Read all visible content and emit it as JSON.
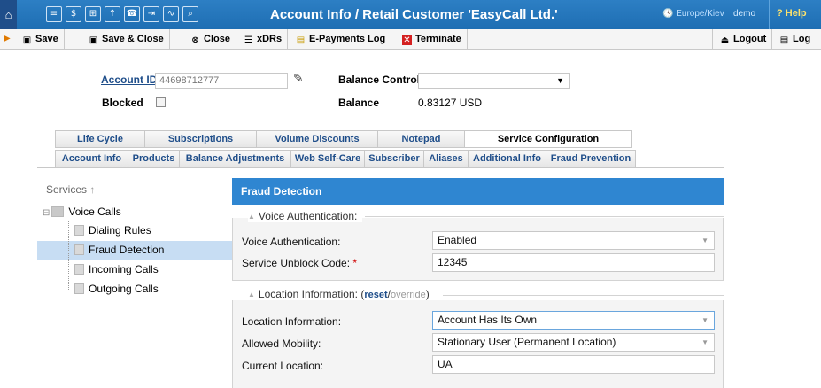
{
  "topbar": {
    "title": "Account Info / Retail Customer 'EasyCall Ltd.'",
    "timezone": "Europe/Kiev",
    "user": "demo",
    "help": "Help"
  },
  "toolbar": {
    "save": "Save",
    "save_close": "Save & Close",
    "close": "Close",
    "xdrs": "xDRs",
    "epayments": "E-Payments Log",
    "terminate": "Terminate",
    "logout": "Logout",
    "log": "Log"
  },
  "account": {
    "id_label": "Account ID",
    "id_value": "44698712777",
    "blocked_label": "Blocked",
    "balance_control_label": "Balance Control",
    "balance_label": "Balance",
    "balance_value": "0.83127 USD"
  },
  "tabs_row1": [
    "Life Cycle",
    "Subscriptions",
    "Volume Discounts",
    "Notepad",
    "Service Configuration"
  ],
  "tabs_row2": [
    "Account Info",
    "Products",
    "Balance Adjustments",
    "Web Self-Care",
    "Subscriber",
    "Aliases",
    "Additional Info",
    "Fraud Prevention"
  ],
  "services": {
    "heading": "Services",
    "root": "Voice Calls",
    "items": [
      "Dialing Rules",
      "Fraud Detection",
      "Incoming Calls",
      "Outgoing Calls"
    ]
  },
  "panel": {
    "title": "Fraud Detection",
    "voice_group": "Voice Authentication:",
    "voice_auth_label": "Voice Authentication:",
    "voice_auth_value": "Enabled",
    "unblock_label": "Service Unblock Code:",
    "unblock_value": "12345",
    "location_group": "Location Information:",
    "reset": "reset",
    "override": "override",
    "location_label": "Location Information:",
    "location_value": "Account Has Its Own",
    "mobility_label": "Allowed Mobility:",
    "mobility_value": "Stationary User (Permanent Location)",
    "current_location_label": "Current Location:",
    "current_location_value": "UA"
  }
}
